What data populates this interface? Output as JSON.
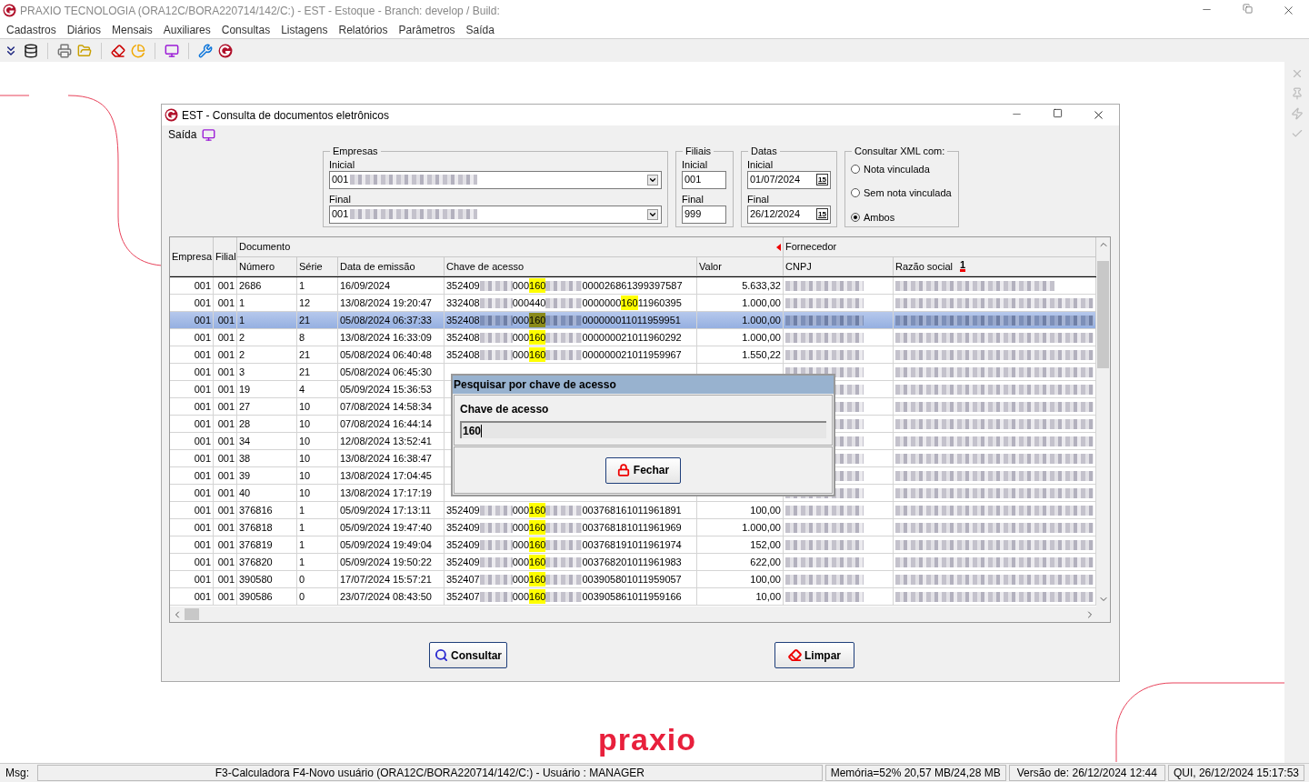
{
  "app": {
    "title": "PRAXIO TECNOLOGIA (ORA12C/BORA220714/142/C:) - EST - Estoque - Branch: develop / Build:"
  },
  "menu": [
    "Cadastros",
    "Diários",
    "Mensais",
    "Auxiliares",
    "Consultas",
    "Listagens",
    "Relatórios",
    "Parâmetros",
    "Saída"
  ],
  "window": {
    "title": "EST - Consulta de documentos eletrônicos",
    "menu": [
      "Saída"
    ],
    "filters": {
      "empresas": {
        "legend": "Empresas",
        "inicial_label": "Inicial",
        "inicial_value": "001",
        "final_label": "Final",
        "final_value": "001"
      },
      "filiais": {
        "legend": "Filiais",
        "inicial_label": "Inicial",
        "inicial_value": "001",
        "final_label": "Final",
        "final_value": "999"
      },
      "datas": {
        "legend": "Datas",
        "inicial_label": "Inicial",
        "inicial_value": "01/07/2024",
        "final_label": "Final",
        "final_value": "26/12/2024",
        "inicial_calendar_label": "15",
        "final_calendar_label": "15"
      },
      "consultar": {
        "legend": "Consultar XML com:",
        "options": [
          {
            "label": "Nota vinculada",
            "selected": false
          },
          {
            "label": "Sem nota vinculada",
            "selected": false
          },
          {
            "label": "Ambos",
            "selected": true
          }
        ]
      }
    },
    "table": {
      "groups": [
        "Documento",
        "Fornecedor"
      ],
      "columns": [
        "Empresa",
        "Filial",
        "Número",
        "Série",
        "Data de emissão",
        "Chave de acesso",
        "Valor",
        "CNPJ",
        "Razão social"
      ],
      "sort_order": "1",
      "rows": [
        {
          "empresa": "001",
          "filial": "001",
          "numero": "2686",
          "serie": "1",
          "data": "16/09/2024",
          "chave": [
            {
              "kind": "text",
              "text": "352409"
            },
            {
              "kind": "blur"
            },
            {
              "kind": "text",
              "text": "000"
            },
            {
              "kind": "match",
              "text": "160"
            },
            {
              "kind": "blur"
            },
            {
              "kind": "text",
              "text": "000026861399397587"
            }
          ],
          "valor": "5.633,32",
          "selected": false
        },
        {
          "empresa": "001",
          "filial": "001",
          "numero": "1",
          "serie": "12",
          "data": "13/08/2024 19:20:47",
          "chave": [
            {
              "kind": "text",
              "text": "332408"
            },
            {
              "kind": "blur"
            },
            {
              "kind": "text",
              "text": "000440"
            },
            {
              "kind": "blur"
            },
            {
              "kind": "text",
              "text": "0000000"
            },
            {
              "kind": "match",
              "text": "160"
            },
            {
              "kind": "text",
              "text": "11960395"
            }
          ],
          "valor": "1.000,00",
          "selected": false
        },
        {
          "empresa": "001",
          "filial": "001",
          "numero": "1",
          "serie": "21",
          "data": "05/08/2024 06:37:33",
          "chave": [
            {
              "kind": "text",
              "text": "352408"
            },
            {
              "kind": "blur"
            },
            {
              "kind": "text",
              "text": "000"
            },
            {
              "kind": "match",
              "text": "160"
            },
            {
              "kind": "blur"
            },
            {
              "kind": "text",
              "text": "000000011011959951"
            }
          ],
          "valor": "1.000,00",
          "selected": true
        },
        {
          "empresa": "001",
          "filial": "001",
          "numero": "2",
          "serie": "8",
          "data": "13/08/2024 16:33:09",
          "chave": [
            {
              "kind": "text",
              "text": "352408"
            },
            {
              "kind": "blur"
            },
            {
              "kind": "text",
              "text": "000"
            },
            {
              "kind": "match",
              "text": "160"
            },
            {
              "kind": "blur"
            },
            {
              "kind": "text",
              "text": "000000021011960292"
            }
          ],
          "valor": "1.000,00",
          "selected": false
        },
        {
          "empresa": "001",
          "filial": "001",
          "numero": "2",
          "serie": "21",
          "data": "05/08/2024 06:40:48",
          "chave": [
            {
              "kind": "text",
              "text": "352408"
            },
            {
              "kind": "blur"
            },
            {
              "kind": "text",
              "text": "000"
            },
            {
              "kind": "match",
              "text": "160"
            },
            {
              "kind": "blur"
            },
            {
              "kind": "text",
              "text": "000000021011959967"
            }
          ],
          "valor": "1.550,22",
          "selected": false
        },
        {
          "empresa": "001",
          "filial": "001",
          "numero": "3",
          "serie": "21",
          "data": "05/08/2024 06:45:30",
          "chave": [],
          "valor": "",
          "selected": false
        },
        {
          "empresa": "001",
          "filial": "001",
          "numero": "19",
          "serie": "4",
          "data": "05/09/2024 15:36:53",
          "chave": [],
          "valor": "",
          "selected": false
        },
        {
          "empresa": "001",
          "filial": "001",
          "numero": "27",
          "serie": "10",
          "data": "07/08/2024 14:58:34",
          "chave": [],
          "valor": "",
          "selected": false
        },
        {
          "empresa": "001",
          "filial": "001",
          "numero": "28",
          "serie": "10",
          "data": "07/08/2024 16:44:14",
          "chave": [],
          "valor": "",
          "selected": false
        },
        {
          "empresa": "001",
          "filial": "001",
          "numero": "34",
          "serie": "10",
          "data": "12/08/2024 13:52:41",
          "chave": [],
          "valor": "",
          "selected": false
        },
        {
          "empresa": "001",
          "filial": "001",
          "numero": "38",
          "serie": "10",
          "data": "13/08/2024 16:38:47",
          "chave": [],
          "valor": "",
          "selected": false
        },
        {
          "empresa": "001",
          "filial": "001",
          "numero": "39",
          "serie": "10",
          "data": "13/08/2024 17:04:45",
          "chave": [],
          "valor": "",
          "selected": false
        },
        {
          "empresa": "001",
          "filial": "001",
          "numero": "40",
          "serie": "10",
          "data": "13/08/2024 17:17:19",
          "chave": [],
          "valor": "",
          "selected": false
        },
        {
          "empresa": "001",
          "filial": "001",
          "numero": "376816",
          "serie": "1",
          "data": "05/09/2024 17:13:11",
          "chave": [
            {
              "kind": "text",
              "text": "352409"
            },
            {
              "kind": "blur"
            },
            {
              "kind": "text",
              "text": "000"
            },
            {
              "kind": "match",
              "text": "160"
            },
            {
              "kind": "blur"
            },
            {
              "kind": "text",
              "text": "003768161011961891"
            }
          ],
          "valor": "100,00",
          "selected": false
        },
        {
          "empresa": "001",
          "filial": "001",
          "numero": "376818",
          "serie": "1",
          "data": "05/09/2024 19:47:40",
          "chave": [
            {
              "kind": "text",
              "text": "352409"
            },
            {
              "kind": "blur"
            },
            {
              "kind": "text",
              "text": "000"
            },
            {
              "kind": "match",
              "text": "160"
            },
            {
              "kind": "blur"
            },
            {
              "kind": "text",
              "text": "003768181011961969"
            }
          ],
          "valor": "1.000,00",
          "selected": false
        },
        {
          "empresa": "001",
          "filial": "001",
          "numero": "376819",
          "serie": "1",
          "data": "05/09/2024 19:49:04",
          "chave": [
            {
              "kind": "text",
              "text": "352409"
            },
            {
              "kind": "blur"
            },
            {
              "kind": "text",
              "text": "000"
            },
            {
              "kind": "match",
              "text": "160"
            },
            {
              "kind": "blur"
            },
            {
              "kind": "text",
              "text": "003768191011961974"
            }
          ],
          "valor": "152,00",
          "selected": false
        },
        {
          "empresa": "001",
          "filial": "001",
          "numero": "376820",
          "serie": "1",
          "data": "05/09/2024 19:50:22",
          "chave": [
            {
              "kind": "text",
              "text": "352409"
            },
            {
              "kind": "blur"
            },
            {
              "kind": "text",
              "text": "000"
            },
            {
              "kind": "match",
              "text": "160"
            },
            {
              "kind": "blur"
            },
            {
              "kind": "text",
              "text": "003768201011961983"
            }
          ],
          "valor": "622,00",
          "selected": false
        },
        {
          "empresa": "001",
          "filial": "001",
          "numero": "390580",
          "serie": "0",
          "data": "17/07/2024 15:57:21",
          "chave": [
            {
              "kind": "text",
              "text": "352407"
            },
            {
              "kind": "blur"
            },
            {
              "kind": "text",
              "text": "000"
            },
            {
              "kind": "match",
              "text": "160"
            },
            {
              "kind": "blur"
            },
            {
              "kind": "text",
              "text": "003905801011959057"
            }
          ],
          "valor": "100,00",
          "selected": false
        },
        {
          "empresa": "001",
          "filial": "001",
          "numero": "390586",
          "serie": "0",
          "data": "23/07/2024 08:43:50",
          "chave": [
            {
              "kind": "text",
              "text": "352407"
            },
            {
              "kind": "blur"
            },
            {
              "kind": "text",
              "text": "000"
            },
            {
              "kind": "match",
              "text": "160"
            },
            {
              "kind": "blur"
            },
            {
              "kind": "text",
              "text": "003905861011959166"
            }
          ],
          "valor": "10,00",
          "selected": false
        }
      ]
    },
    "buttons": [
      "Consultar",
      "Limpar"
    ]
  },
  "dialog": {
    "title": "Pesquisar por chave de acesso",
    "label": "Chave de acesso",
    "value": "160",
    "button": "Fechar"
  },
  "logo": "praxio",
  "status_bar": {
    "msg_label": "Msg:",
    "message": "F3-Calculadora F4-Novo usuário (ORA12C/BORA220714/142/C:)  - Usuário : MANAGER",
    "memory": "Memória=52% 20,57 MB/24,28 MB",
    "version": "Versão de: 26/12/2024 12:44",
    "datetime": "QUI, 26/12/2024 15:17:53"
  }
}
